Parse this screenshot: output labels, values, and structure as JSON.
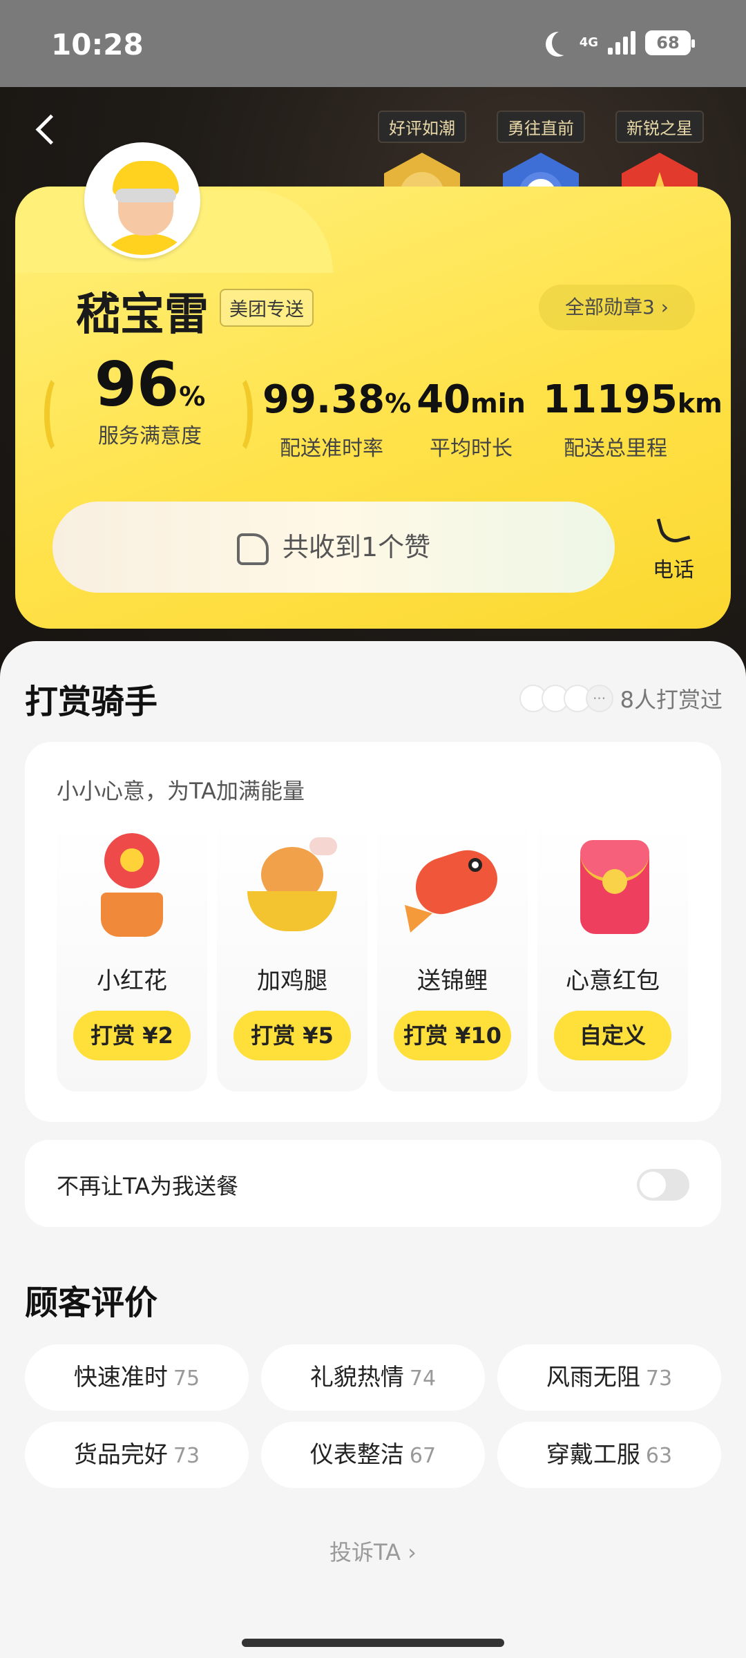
{
  "status_bar": {
    "time": "10:28",
    "network": "4G",
    "battery": "68"
  },
  "medals": [
    {
      "label": "好评如潮",
      "color": "#e6b43a",
      "inner": "#f3cd6a"
    },
    {
      "label": "勇往直前",
      "color": "#3d6fd6",
      "inner": "#ffffff"
    },
    {
      "label": "新锐之星",
      "color": "#e23b2e",
      "inner": "#ffcc4a"
    }
  ],
  "rider": {
    "name": "嵇宝雷",
    "badge": "美团专送",
    "all_medals": "全部勋章3 ›"
  },
  "stats": [
    {
      "value": "96",
      "unit": "%",
      "label": "服务满意度"
    },
    {
      "value": "99.38",
      "unit": "%",
      "label": "配送准时率"
    },
    {
      "value": "40",
      "unit": "min",
      "label": "平均时长"
    },
    {
      "value": "11195",
      "unit": "km",
      "label": "配送总里程"
    }
  ],
  "likes": {
    "text": "共收到1个赞"
  },
  "phone": {
    "label": "电话"
  },
  "tip_section": {
    "title": "打赏骑手",
    "tipped_count": "8人打赏过",
    "subtitle": "小小心意，为TA加满能量",
    "gifts": [
      {
        "name": "小红花",
        "button": "打赏 ¥2",
        "icon": "flower-icon"
      },
      {
        "name": "加鸡腿",
        "button": "打赏 ¥5",
        "icon": "drumstick-icon"
      },
      {
        "name": "送锦鲤",
        "button": "打赏 ¥10",
        "icon": "koi-icon"
      },
      {
        "name": "心意红包",
        "button": "自定义",
        "icon": "red-envelope-icon"
      }
    ]
  },
  "block_rider": {
    "label": "不再让TA为我送餐",
    "enabled": false
  },
  "reviews": {
    "title": "顾客评价",
    "tags": [
      {
        "label": "快速准时",
        "count": "75"
      },
      {
        "label": "礼貌热情",
        "count": "74"
      },
      {
        "label": "风雨无阻",
        "count": "73"
      },
      {
        "label": "货品完好",
        "count": "73"
      },
      {
        "label": "仪表整洁",
        "count": "67"
      },
      {
        "label": "穿戴工服",
        "count": "63"
      }
    ]
  },
  "complain": {
    "label": "投诉TA ›"
  }
}
